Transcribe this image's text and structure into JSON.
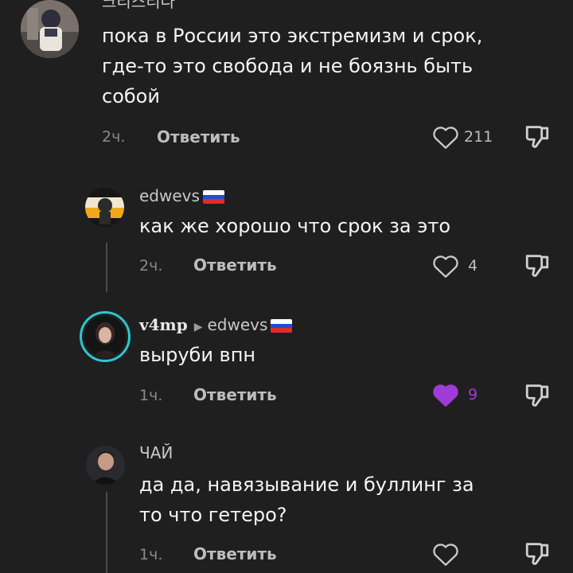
{
  "colors": {
    "background": "#201f20",
    "liked_heart": "#a13bd6",
    "liked_count": "#a13bd6",
    "story_ring": "#2bc7cf"
  },
  "comments": [
    {
      "username": "크리스티나",
      "text_lines": [
        "пока в России это экстремизм и срок,",
        "где-то это свобода и не боязнь быть",
        "собой"
      ],
      "time": "2ч.",
      "reply": "Ответить",
      "likes": "211",
      "liked": false,
      "flag": false
    },
    {
      "username": "edwevs",
      "text_lines": [
        "как же хорошо что срок за это"
      ],
      "time": "2ч.",
      "reply": "Ответить",
      "likes": "4",
      "liked": false,
      "flag": true
    },
    {
      "username": "v4mp",
      "reply_to": "edwevs",
      "text_lines": [
        "выруби впн"
      ],
      "time": "1ч.",
      "reply": "Ответить",
      "likes": "9",
      "liked": true,
      "flag": true
    },
    {
      "username": "ЧАЙ",
      "text_lines": [
        "да да, навязывание и буллинг за",
        "то что гетеро?"
      ],
      "time": "1ч.",
      "reply": "Ответить",
      "likes": "",
      "liked": false,
      "flag": false
    }
  ]
}
